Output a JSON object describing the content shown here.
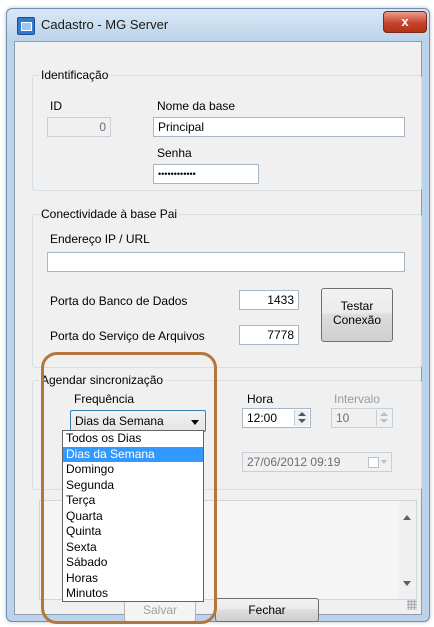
{
  "window": {
    "title": "Cadastro - MG Server",
    "close_glyph": "x"
  },
  "identificacao": {
    "legend": "Identificação",
    "id_label": "ID",
    "id_value": "0",
    "nome_label": "Nome da base",
    "nome_value": "Principal",
    "senha_label": "Senha",
    "senha_value": "••••••••••••"
  },
  "conectividade": {
    "legend": "Conectividade à base Pai",
    "endereco_label": "Endereço IP / URL",
    "endereco_value": "",
    "porta_bd_label": "Porta do Banco de Dados",
    "porta_bd_value": "1433",
    "porta_arq_label": "Porta do Serviço de Arquivos",
    "porta_arq_value": "7778",
    "testar_label": "Testar\nConexão"
  },
  "agendar": {
    "legend": "Agendar sincronização",
    "frequencia_label": "Frequência",
    "frequencia_selected": "Dias da Semana",
    "hora_label": "Hora",
    "hora_value": "12:00",
    "intervalo_label": "Intervalo",
    "intervalo_value": "10",
    "data_value": "27/06/2012 09:19",
    "dropdown_options": [
      "Todos os Dias",
      "Dias da Semana",
      "Domingo",
      "Segunda",
      "Terça",
      "Quarta",
      "Quinta",
      "Sexta",
      "Sábado",
      "Horas",
      "Minutos"
    ],
    "highlighted_index": 1
  },
  "buttons": {
    "salvar": "Salvar",
    "fechar": "Fechar"
  },
  "colors": {
    "selection": "#3399ff",
    "annotation": "#b5763c",
    "close": "#c7432b"
  },
  "icons": [
    "app-icon",
    "close-icon",
    "dropdown-arrow-icon",
    "spin-icon",
    "calendar-icon"
  ]
}
